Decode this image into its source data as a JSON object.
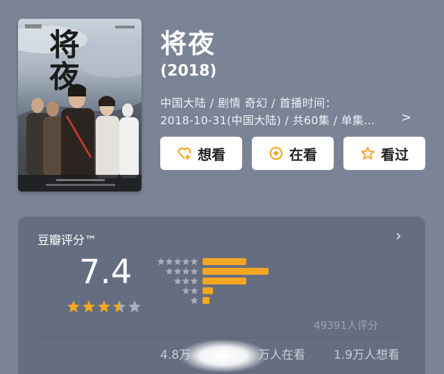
{
  "poster": {
    "title": "将夜",
    "icon": "movie-poster"
  },
  "title": "将夜",
  "year": "(2018)",
  "meta": {
    "line1": "中国大陆 / 剧情 奇幻 / 首播时间：",
    "line2": "2018-10-31(中国大陆) / 共60集 / 单集...",
    "more": ">"
  },
  "buttons": {
    "want": "想看",
    "watching": "在看",
    "watched": "看过"
  },
  "rating": {
    "label": "豆瓣评分™",
    "score": "7.4",
    "stars": 3.5,
    "distribution": [
      {
        "stars": 5,
        "fraction": 0.25
      },
      {
        "stars": 4,
        "fraction": 0.38
      },
      {
        "stars": 3,
        "fraction": 0.25
      },
      {
        "stars": 2,
        "fraction": 0.06
      },
      {
        "stars": 1,
        "fraction": 0.04
      }
    ],
    "count": "49391人评分"
  },
  "stats": {
    "watched": "4.8万",
    "watching": "万人在看",
    "want": "1.9万人想看"
  },
  "colors": {
    "background": "#7b8496",
    "panel": "#656e80",
    "accent": "#f5a623",
    "star_empty": "#a9afbb"
  }
}
